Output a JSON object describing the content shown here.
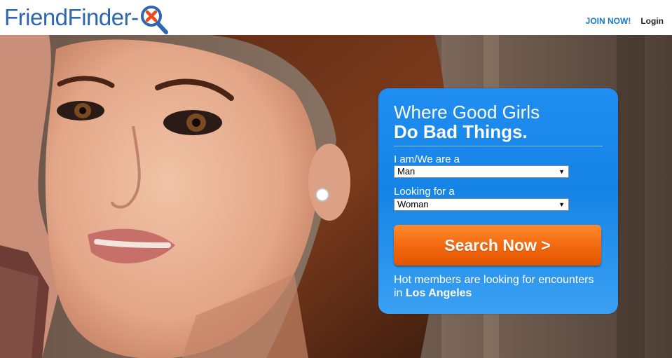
{
  "header": {
    "logo_text": "FriendFinder-",
    "logo_mark": "x",
    "join_label": "JOIN NOW!",
    "login_label": "Login"
  },
  "panel": {
    "headline_line1": "Where Good Girls",
    "headline_line2": "Do Bad Things.",
    "iam_label": "I am/We are a",
    "iam_value": "Man",
    "looking_label": "Looking for a",
    "looking_value": "Woman",
    "search_label": "Search Now >",
    "hot_text": "Hot members are looking for encounters in",
    "city": "Los Angeles"
  },
  "colors": {
    "brand_blue": "#2c67b0",
    "panel_blue": "#1684e6",
    "cta_orange": "#f36a10"
  },
  "icons": {
    "logo_mark": "magnifier-x-icon",
    "dropdown_arrow": "triangle-down-icon"
  }
}
